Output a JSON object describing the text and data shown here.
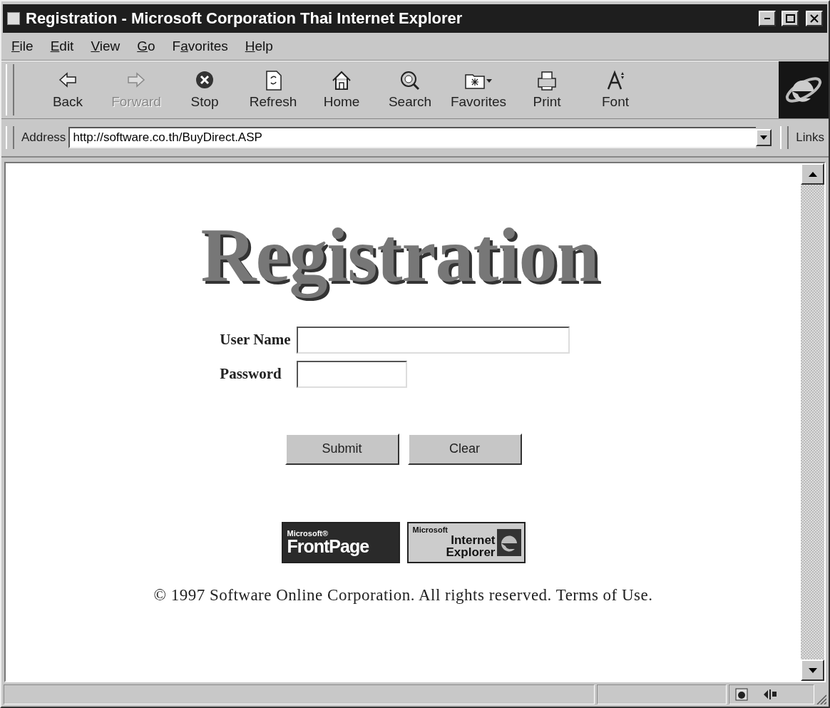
{
  "window": {
    "title": "Registration - Microsoft Corporation Thai Internet Explorer"
  },
  "menu": [
    {
      "key": "F",
      "after": "ile"
    },
    {
      "key": "E",
      "after": "dit"
    },
    {
      "key": "V",
      "after": "iew"
    },
    {
      "key": "G",
      "after": "o"
    },
    {
      "before": "F",
      "key": "a",
      "after": "vorites"
    },
    {
      "key": "H",
      "after": "elp"
    }
  ],
  "toolbar": [
    {
      "label": "Back",
      "kind": "back",
      "disabled": false
    },
    {
      "label": "Forward",
      "kind": "forward",
      "disabled": true
    },
    {
      "label": "Stop",
      "kind": "stop",
      "disabled": false
    },
    {
      "label": "Refresh",
      "kind": "refresh",
      "disabled": false
    },
    {
      "label": "Home",
      "kind": "home",
      "disabled": false
    },
    {
      "label": "Search",
      "kind": "search",
      "disabled": false
    },
    {
      "label": "Favorites",
      "kind": "favorites",
      "disabled": false
    },
    {
      "label": "Print",
      "kind": "print",
      "disabled": false
    },
    {
      "label": "Font",
      "kind": "font",
      "disabled": false
    }
  ],
  "address_bar": {
    "label": "Address",
    "value": "http://software.co.th/BuyDirect.ASP",
    "links": "Links"
  },
  "page": {
    "heading": "Registration",
    "fields": [
      {
        "label": "User Name",
        "kind": "text"
      },
      {
        "label": "Password",
        "kind": "password"
      }
    ],
    "buttons": [
      "Submit",
      "Clear"
    ],
    "badges": [
      {
        "kind": "frontpage",
        "top": "Microsoft®",
        "main": "FrontPage"
      },
      {
        "kind": "ie",
        "top": "Microsoft",
        "main": "Internet Explorer"
      }
    ],
    "footer": "© 1997 Software Online Corporation. All rights reserved. Terms of Use."
  }
}
